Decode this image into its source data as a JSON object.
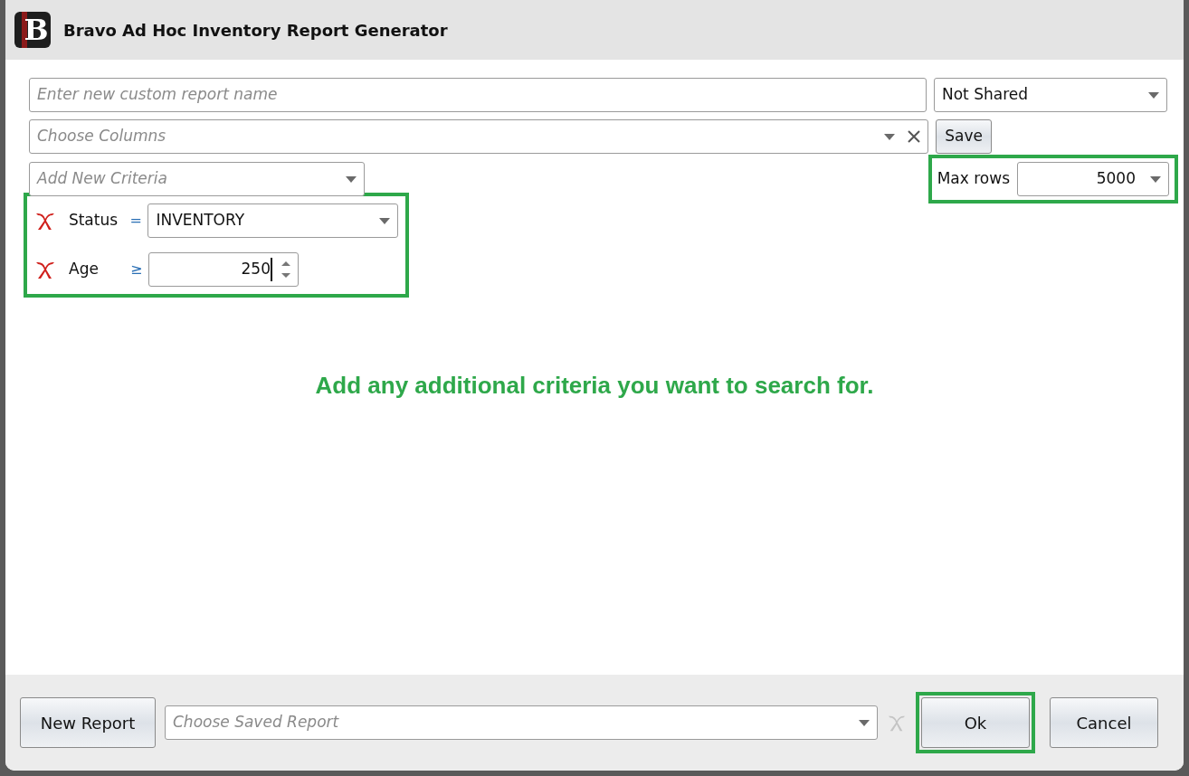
{
  "window": {
    "logo_text": "B",
    "title": "Bravo Ad Hoc Inventory Report Generator"
  },
  "report_name": {
    "placeholder": "Enter new custom report name"
  },
  "sharing": {
    "value": "Not Shared"
  },
  "columns": {
    "placeholder": "Choose Columns"
  },
  "save_button": "Save",
  "add_criteria": {
    "placeholder": "Add New Criteria"
  },
  "max_rows": {
    "label": "Max rows",
    "value": "5000",
    "highlighted": true
  },
  "criteria_group": {
    "highlighted": true,
    "items": [
      {
        "kind": "dropdown",
        "field": "Status",
        "operator": "=",
        "value": "INVENTORY"
      },
      {
        "kind": "number",
        "field": "Age",
        "operator": "≥",
        "value": "250"
      }
    ]
  },
  "instruction": "Add any additional criteria you want to search for.",
  "footer": {
    "new_report_button": "New Report",
    "saved_report": {
      "placeholder": "Choose Saved Report"
    },
    "delete_saved_disabled": true,
    "buttons": [
      {
        "label": "Ok",
        "highlighted": true
      },
      {
        "label": "Cancel",
        "highlighted": false
      }
    ]
  }
}
